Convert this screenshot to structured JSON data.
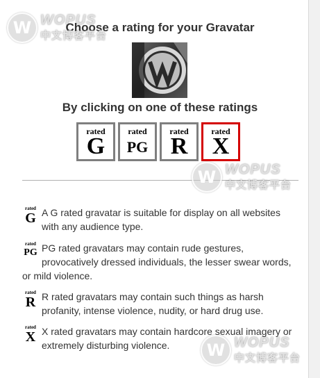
{
  "header": {
    "title": "Choose a rating for your Gravatar",
    "subtitle": "By clicking on one of these ratings"
  },
  "avatar": {
    "icon": "wordpress-logo-icon"
  },
  "ratings": [
    {
      "rated": "rated",
      "grade": "G",
      "selected": false
    },
    {
      "rated": "rated",
      "grade": "PG",
      "selected": false
    },
    {
      "rated": "rated",
      "grade": "R",
      "selected": false
    },
    {
      "rated": "rated",
      "grade": "X",
      "selected": true
    }
  ],
  "selected_border_color": "#d40000",
  "descriptions": [
    {
      "rated": "rated",
      "grade": "G",
      "text": "A G rated gravatar is suitable for display on all websites with any audience type."
    },
    {
      "rated": "rated",
      "grade": "PG",
      "text": "PG rated gravatars may contain rude gestures, provocatively dressed individuals, the lesser swear words, or mild violence."
    },
    {
      "rated": "rated",
      "grade": "R",
      "text": "R rated gravatars may contain such things as harsh profanity, intense violence, nudity, or hard drug use."
    },
    {
      "rated": "rated",
      "grade": "X",
      "text": "X rated gravatars may contain hardcore sexual imagery or extremely disturbing violence."
    }
  ],
  "watermark": {
    "brand": "WOPUS",
    "cn": "中文博客平台",
    "letter": "W"
  }
}
